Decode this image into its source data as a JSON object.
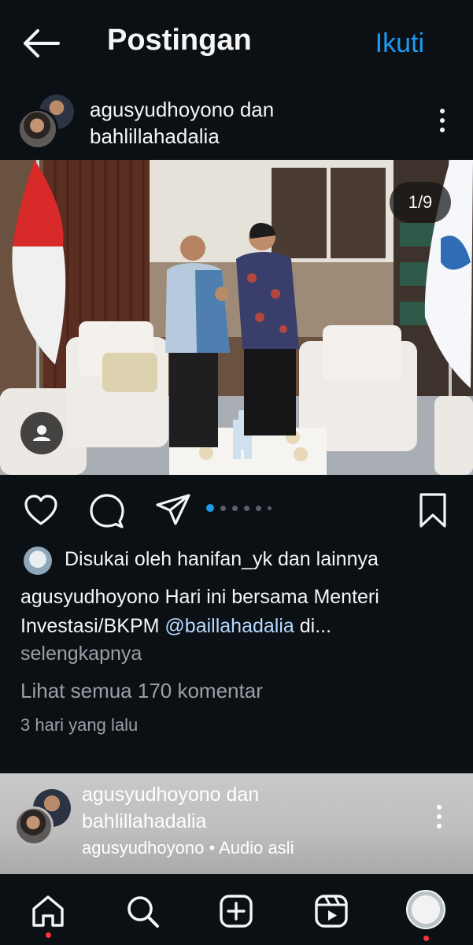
{
  "topbar": {
    "title": "Postingan",
    "follow_label": "Ikuti"
  },
  "post": {
    "authors": [
      "agusyudhoyono dan",
      "bahlillahadalia"
    ],
    "counter": "1/9",
    "liked_by": "Disukai oleh hanifan_yk dan lainnya",
    "caption_user": "agusyudhoyono",
    "caption_text_1": " Hari ini bersama Menteri Investasi/BKPM ",
    "mention": "@baillahadalia",
    "caption_text_2": " di...",
    "more_label": "selengkapnya",
    "comments_label": "Lihat semua 170 komentar",
    "time": "3 hari yang lalu"
  },
  "next_post": {
    "authors": [
      "agusyudhoyono dan",
      "bahlillahadalia"
    ],
    "audio": "agusyudhoyono • Audio asli"
  },
  "colors": {
    "accent": "#1d9bf0",
    "notification": "#ff3040",
    "background": "#0b1014"
  },
  "icons": [
    "back-arrow-icon",
    "more-vertical-icon",
    "person-tag-icon",
    "heart-icon",
    "comment-icon",
    "share-icon",
    "bookmark-icon",
    "home-icon",
    "search-icon",
    "create-icon",
    "reels-icon"
  ]
}
